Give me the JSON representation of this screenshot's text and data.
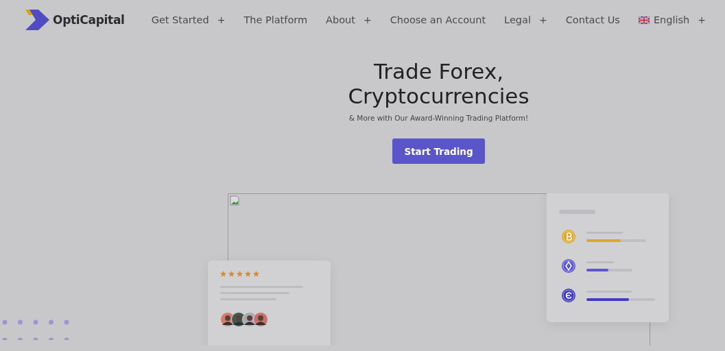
{
  "brand": {
    "name": "OptiCapital"
  },
  "nav": [
    {
      "label": "Get Started",
      "toggle": "+"
    },
    {
      "label": "The Platform"
    },
    {
      "label": "About",
      "toggle": "+"
    },
    {
      "label": "Choose an Account"
    },
    {
      "label": "Legal",
      "toggle": "+"
    },
    {
      "label": "Contact Us"
    },
    {
      "label": "English",
      "toggle": "+",
      "kind": "language"
    }
  ],
  "hero": {
    "title_lines": [
      "Trade Forex,",
      "Cryptocurrencies"
    ],
    "subtitle": "& More with Our Award-Winning Trading Platform!",
    "button": "Start Trading"
  },
  "review_card": {
    "stars": 5
  },
  "coin_card": {
    "items": [
      {
        "kind": "bitcoin",
        "color": "#e0a62a",
        "level": 0.58
      },
      {
        "kind": "ether",
        "color": "#5b57d0",
        "level": 0.48
      },
      {
        "kind": "coin",
        "color": "#3f3cc0",
        "level": 0.62
      }
    ]
  }
}
